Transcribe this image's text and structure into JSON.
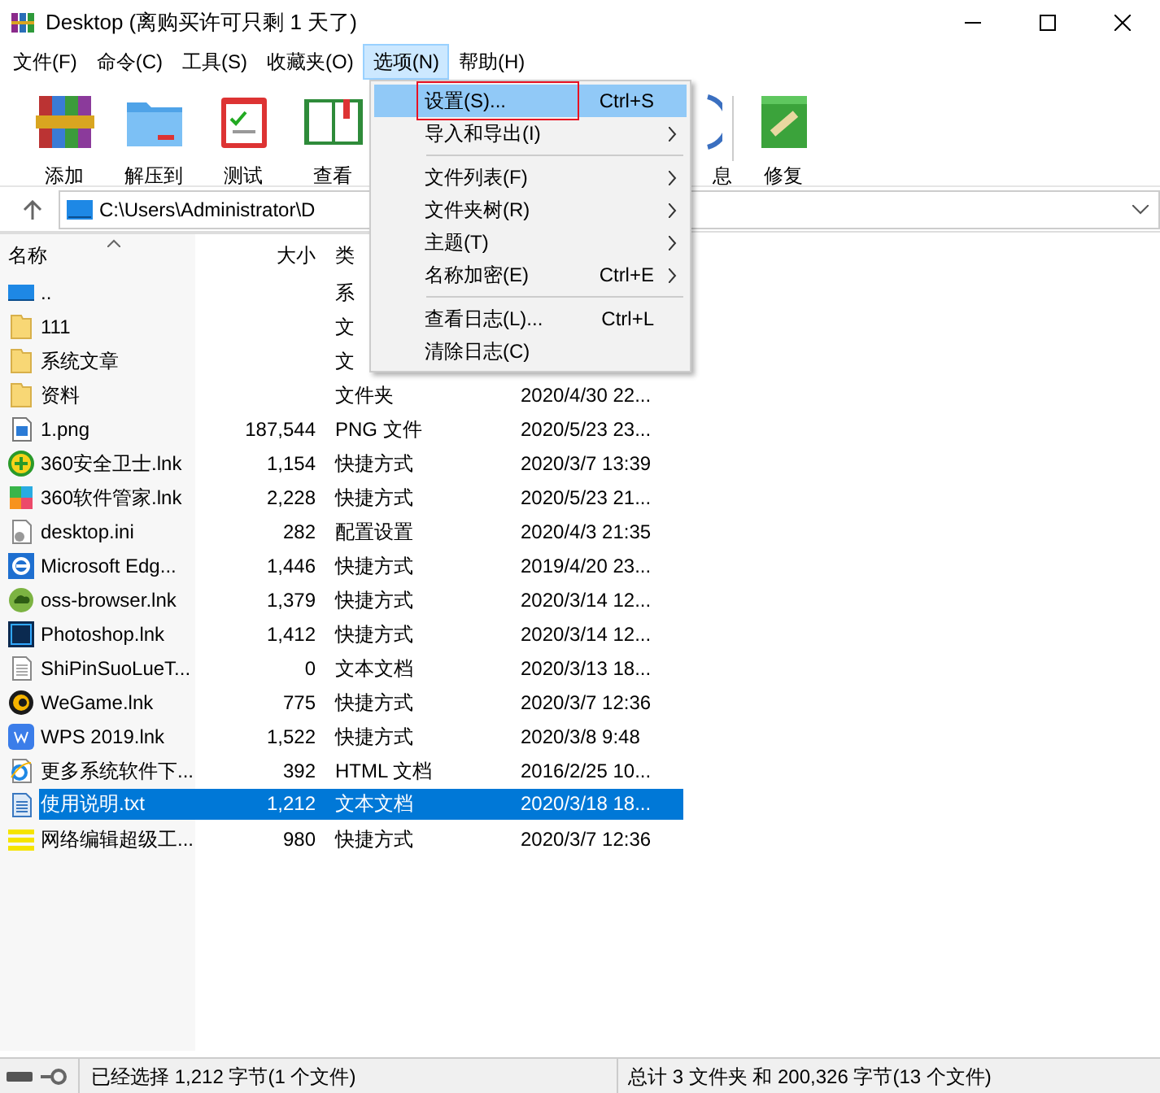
{
  "window": {
    "title": "Desktop (离购买许可只剩 1 天了)"
  },
  "menubar": [
    {
      "label": "文件(F)",
      "selected": false
    },
    {
      "label": "命令(C)",
      "selected": false
    },
    {
      "label": "工具(S)",
      "selected": false
    },
    {
      "label": "收藏夹(O)",
      "selected": false
    },
    {
      "label": "选项(N)",
      "selected": true
    },
    {
      "label": "帮助(H)",
      "selected": false
    }
  ],
  "toolbar": [
    {
      "label": "添加",
      "kind": "books"
    },
    {
      "label": "解压到",
      "kind": "folder"
    },
    {
      "label": "测试",
      "kind": "clipboard"
    },
    {
      "label": "查看",
      "kind": "book"
    },
    {
      "label": "息",
      "kind": "info"
    },
    {
      "label": "修复",
      "kind": "repair"
    }
  ],
  "address": {
    "path": "C:\\Users\\Administrator\\D"
  },
  "columns": [
    "名称",
    "大小",
    "类"
  ],
  "rows": [
    {
      "name": "..",
      "size": "",
      "type": "系",
      "date": "",
      "kind": "up",
      "selected": false
    },
    {
      "name": "111",
      "size": "",
      "type": "文",
      "date": "",
      "kind": "folder",
      "selected": false
    },
    {
      "name": "系统文章",
      "size": "",
      "type": "文",
      "date": "",
      "kind": "folder",
      "selected": false
    },
    {
      "name": "资料",
      "size": "",
      "type": "文件夹",
      "date": "2020/4/30 22...",
      "kind": "folder",
      "selected": false
    },
    {
      "name": "1.png",
      "size": "187,544",
      "type": "PNG 文件",
      "date": "2020/5/23 23...",
      "kind": "image",
      "selected": false
    },
    {
      "name": "360安全卫士.lnk",
      "size": "1,154",
      "type": "快捷方式",
      "date": "2020/3/7 13:39",
      "kind": "plus",
      "selected": false
    },
    {
      "name": "360软件管家.lnk",
      "size": "2,228",
      "type": "快捷方式",
      "date": "2020/5/23 21...",
      "kind": "tiles",
      "selected": false
    },
    {
      "name": "desktop.ini",
      "size": "282",
      "type": "配置设置",
      "date": "2020/4/3 21:35",
      "kind": "gear",
      "selected": false
    },
    {
      "name": "Microsoft Edg...",
      "size": "1,446",
      "type": "快捷方式",
      "date": "2019/4/20 23...",
      "kind": "edge",
      "selected": false
    },
    {
      "name": "oss-browser.lnk",
      "size": "1,379",
      "type": "快捷方式",
      "date": "2020/3/14 12...",
      "kind": "cloud",
      "selected": false
    },
    {
      "name": "Photoshop.lnk",
      "size": "1,412",
      "type": "快捷方式",
      "date": "2020/3/14 12...",
      "kind": "ps",
      "selected": false
    },
    {
      "name": "ShiPinSuoLueT...",
      "size": "0",
      "type": "文本文档",
      "date": "2020/3/13 18...",
      "kind": "text",
      "selected": false
    },
    {
      "name": "WeGame.lnk",
      "size": "775",
      "type": "快捷方式",
      "date": "2020/3/7 12:36",
      "kind": "wegame",
      "selected": false
    },
    {
      "name": "WPS 2019.lnk",
      "size": "1,522",
      "type": "快捷方式",
      "date": "2020/3/8 9:48",
      "kind": "wps",
      "selected": false
    },
    {
      "name": "更多系统软件下...",
      "size": "392",
      "type": "HTML 文档",
      "date": "2016/2/25 10...",
      "kind": "ie",
      "selected": false
    },
    {
      "name": "使用说明.txt",
      "size": "1,212",
      "type": "文本文档",
      "date": "2020/3/18 18...",
      "kind": "textblue",
      "selected": true
    },
    {
      "name": "网络编辑超级工...",
      "size": "980",
      "type": "快捷方式",
      "date": "2020/3/7 12:36",
      "kind": "stripes",
      "selected": false
    }
  ],
  "menu": [
    {
      "kind": "item",
      "label": "设置(S)...",
      "shortcut": "Ctrl+S",
      "submenu": false,
      "selected": true
    },
    {
      "kind": "item",
      "label": "导入和导出(I)",
      "submenu": true,
      "selected": false
    },
    {
      "kind": "separator"
    },
    {
      "kind": "item",
      "label": "文件列表(F)",
      "submenu": true,
      "selected": false
    },
    {
      "kind": "item",
      "label": "文件夹树(R)",
      "submenu": true,
      "selected": false
    },
    {
      "kind": "item",
      "label": "主题(T)",
      "submenu": true,
      "selected": false
    },
    {
      "kind": "item",
      "label": "名称加密(E)",
      "shortcut": "Ctrl+E",
      "submenu": true,
      "selected": false
    },
    {
      "kind": "separator"
    },
    {
      "kind": "item",
      "label": "查看日志(L)...",
      "shortcut": "Ctrl+L",
      "submenu": false,
      "selected": false
    },
    {
      "kind": "item",
      "label": "清除日志(C)",
      "submenu": false,
      "selected": false
    }
  ],
  "status_bar": {
    "left": "已经选择 1,212 字节(1 个文件)",
    "right": "总计 3 文件夹 和 200,326 字节(13 个文件)"
  }
}
